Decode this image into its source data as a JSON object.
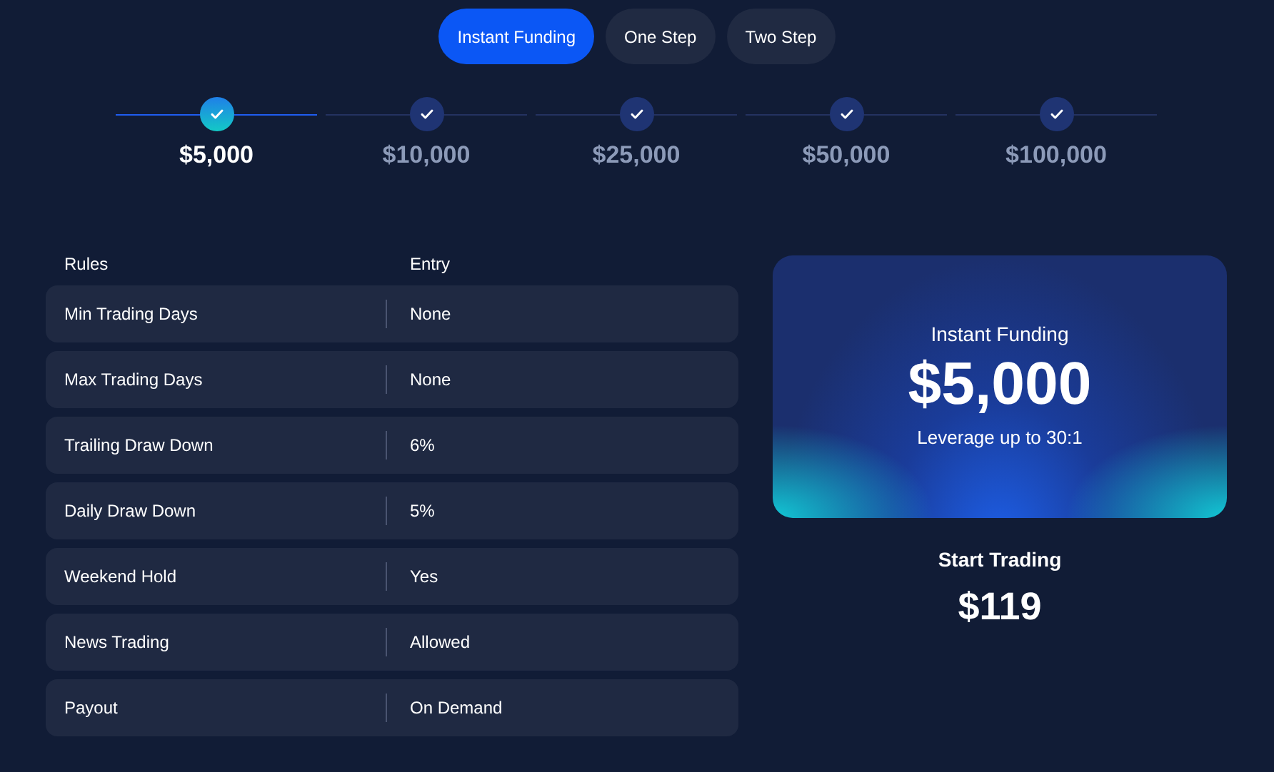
{
  "tabs": [
    {
      "label": "Instant Funding",
      "selected": true
    },
    {
      "label": "One Step",
      "selected": false
    },
    {
      "label": "Two Step",
      "selected": false
    }
  ],
  "steps": [
    {
      "label": "$5,000",
      "selected": true
    },
    {
      "label": "$10,000",
      "selected": false
    },
    {
      "label": "$25,000",
      "selected": false
    },
    {
      "label": "$50,000",
      "selected": false
    },
    {
      "label": "$100,000",
      "selected": false
    }
  ],
  "table": {
    "columns": [
      "Rules",
      "Entry"
    ],
    "rows": [
      [
        "Min Trading Days",
        "None"
      ],
      [
        "Max Trading Days",
        "None"
      ],
      [
        "Trailing Draw Down",
        "6%"
      ],
      [
        "Daily Draw Down",
        "5%"
      ],
      [
        "Weekend Hold",
        "Yes"
      ],
      [
        "News Trading",
        "Allowed"
      ],
      [
        "Payout",
        "On Demand"
      ]
    ]
  },
  "card": {
    "title": "Instant Funding",
    "amount": "$5,000",
    "subtitle": "Leverage up to 30:1"
  },
  "price": {
    "label": "Start Trading",
    "amount": "$119"
  }
}
